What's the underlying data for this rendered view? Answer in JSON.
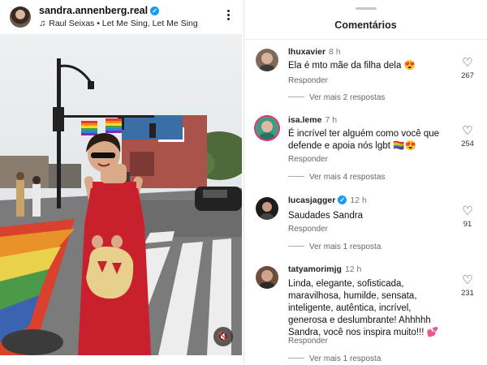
{
  "post": {
    "username": "sandra.annenberg.real",
    "verified_mark": "✓",
    "music_note": "♫",
    "music": "Raul Seixas • Let Me Sing, Let Me Sing",
    "more_icon": "more-vertical-icon",
    "mute_icon": "mute-icon",
    "mute_glyph": "🔇"
  },
  "comments_panel": {
    "title": "Comentários",
    "comments": [
      {
        "username": "lhuxavier",
        "time": "8 h",
        "text": "Ela é mto mãe da filha dela 😍",
        "reply_label": "Responder",
        "more_replies": "Ver mais 2 respostas",
        "likes": "267"
      },
      {
        "username": "isa.leme",
        "time": "7 h",
        "text": "É incrível ter alguém como você que defende e apoia nós lgbt 🏳️‍🌈😍",
        "reply_label": "Responder",
        "more_replies": "Ver mais 4 respostas",
        "likes": "254"
      },
      {
        "username": "lucasjagger",
        "verified_mark": "✓",
        "time": "12 h",
        "text": "Saudades Sandra",
        "reply_label": "Responder",
        "more_replies": "Ver mais 1 resposta",
        "likes": "91"
      },
      {
        "username": "tatyamorimjg",
        "time": "12 h",
        "text": "Linda, elegante, sofisticada, maravilhosa, humilde, sensata, inteligente, autêntica, incrível, generosa e deslumbrante! Ahhhhh Sandra, você nos inspira muito!!! 💕",
        "reply_label": "Responder",
        "more_replies": "Ver mais 1 resposta",
        "likes": "231"
      }
    ],
    "heart_glyph": "♡"
  },
  "colors": {
    "verified": "#1d9bf0",
    "dress": "#c8202c",
    "text": "#111111",
    "secondary_text": "#666666"
  }
}
